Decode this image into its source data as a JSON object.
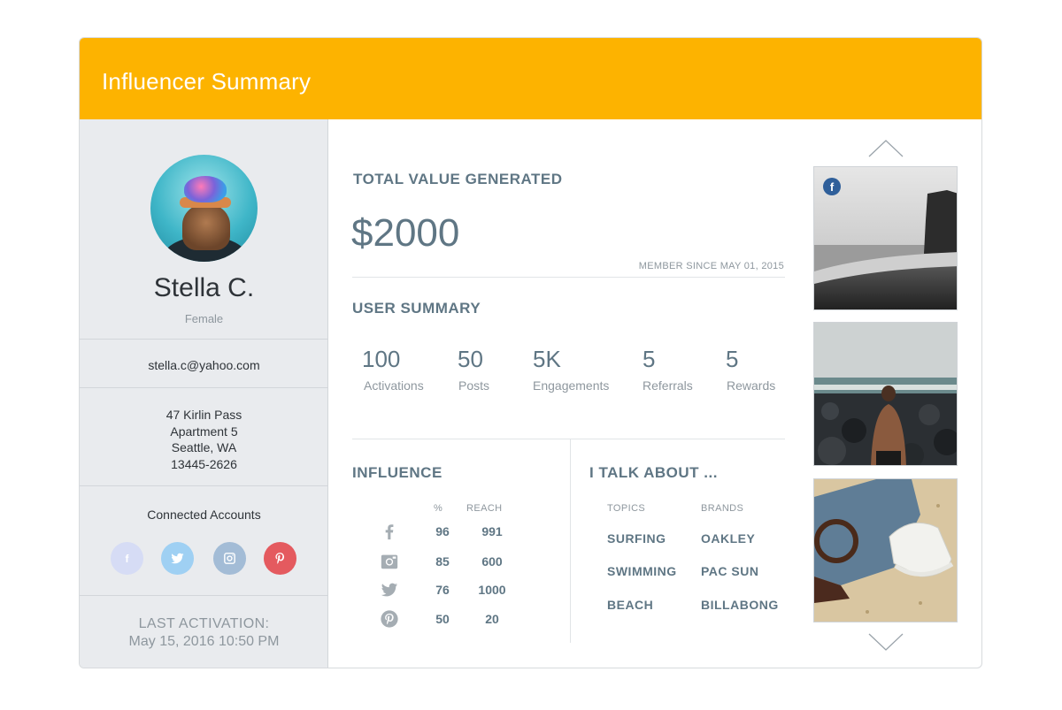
{
  "header": {
    "title": "Influencer Summary"
  },
  "profile": {
    "name": "Stella C.",
    "gender": "Female",
    "email": "stella.c@yahoo.com",
    "address": [
      "47 Kirlin Pass",
      "Apartment 5",
      "Seattle, WA",
      "13445-2626"
    ],
    "connected_title": "Connected Accounts",
    "connected_accounts": [
      {
        "icon": "facebook-icon",
        "color": "#d6dcf5"
      },
      {
        "icon": "twitter-icon",
        "color": "#9fd0f3"
      },
      {
        "icon": "instagram-icon",
        "color": "#a3bcd6"
      },
      {
        "icon": "pinterest-icon",
        "color": "#e45a5f"
      }
    ],
    "last_activation_label": "LAST ACTIVATION:",
    "last_activation_date": "May 15, 2016 10:50 PM"
  },
  "value": {
    "title": "TOTAL VALUE GENERATED",
    "amount": "$2000",
    "member_since": "MEMBER SINCE MAY 01, 2015"
  },
  "summary": {
    "title": "USER SUMMARY",
    "stats": [
      {
        "value": "100",
        "label": "Activations"
      },
      {
        "value": "50",
        "label": "Posts"
      },
      {
        "value": "5K",
        "label": "Engagements"
      },
      {
        "value": "5",
        "label": "Referrals"
      },
      {
        "value": "5",
        "label": "Rewards"
      }
    ]
  },
  "influence": {
    "title": "INFLUENCE",
    "col_pct": "%",
    "col_reach": "REACH",
    "rows": [
      {
        "icon": "facebook-icon",
        "pct": "96",
        "reach": "991"
      },
      {
        "icon": "instagram-icon",
        "pct": "85",
        "reach": "600"
      },
      {
        "icon": "twitter-icon",
        "pct": "76",
        "reach": "1000"
      },
      {
        "icon": "pinterest-icon",
        "pct": "50",
        "reach": "20"
      }
    ]
  },
  "talk": {
    "title": "I TALK ABOUT ...",
    "topics_label": "TOPICS",
    "brands_label": "BRANDS",
    "topics": [
      "SURFING",
      "SWIMMING",
      "BEACH"
    ],
    "brands": [
      "OAKLEY",
      "PAC SUN",
      "BILLABONG"
    ]
  },
  "colors": {
    "header": "#fdb300",
    "sidebar": "#e9ebee",
    "accent_text": "#5f7684"
  }
}
